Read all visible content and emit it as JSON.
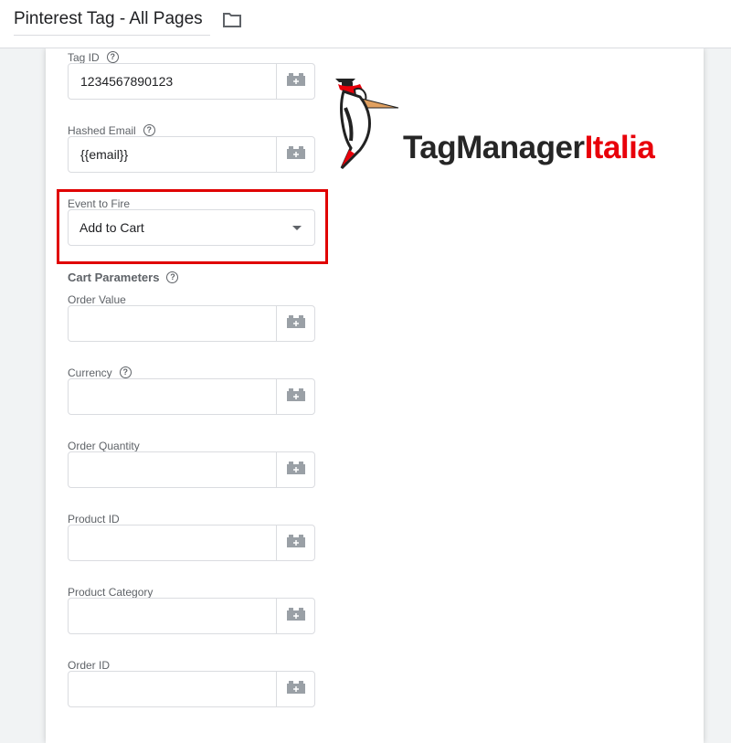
{
  "header": {
    "title": "Pinterest Tag - All Pages",
    "folder_icon": "folder-icon"
  },
  "fields": {
    "tag_id": {
      "label": "Tag ID",
      "value": "1234567890123"
    },
    "hashed_email": {
      "label": "Hashed Email",
      "value": "{{email}}"
    },
    "event": {
      "label": "Event to Fire",
      "value": "Add to Cart"
    }
  },
  "cart": {
    "title": "Cart Parameters",
    "items": [
      {
        "label": "Order Value",
        "value": ""
      },
      {
        "label": "Currency",
        "value": ""
      },
      {
        "label": "Order Quantity",
        "value": ""
      },
      {
        "label": "Product ID",
        "value": ""
      },
      {
        "label": "Product Category",
        "value": ""
      },
      {
        "label": "Order ID",
        "value": ""
      }
    ]
  },
  "logo": {
    "text_dark": "TagManager",
    "text_red": "Italia"
  },
  "colors": {
    "highlight": "#e00000",
    "brand_red": "#e8000a"
  }
}
